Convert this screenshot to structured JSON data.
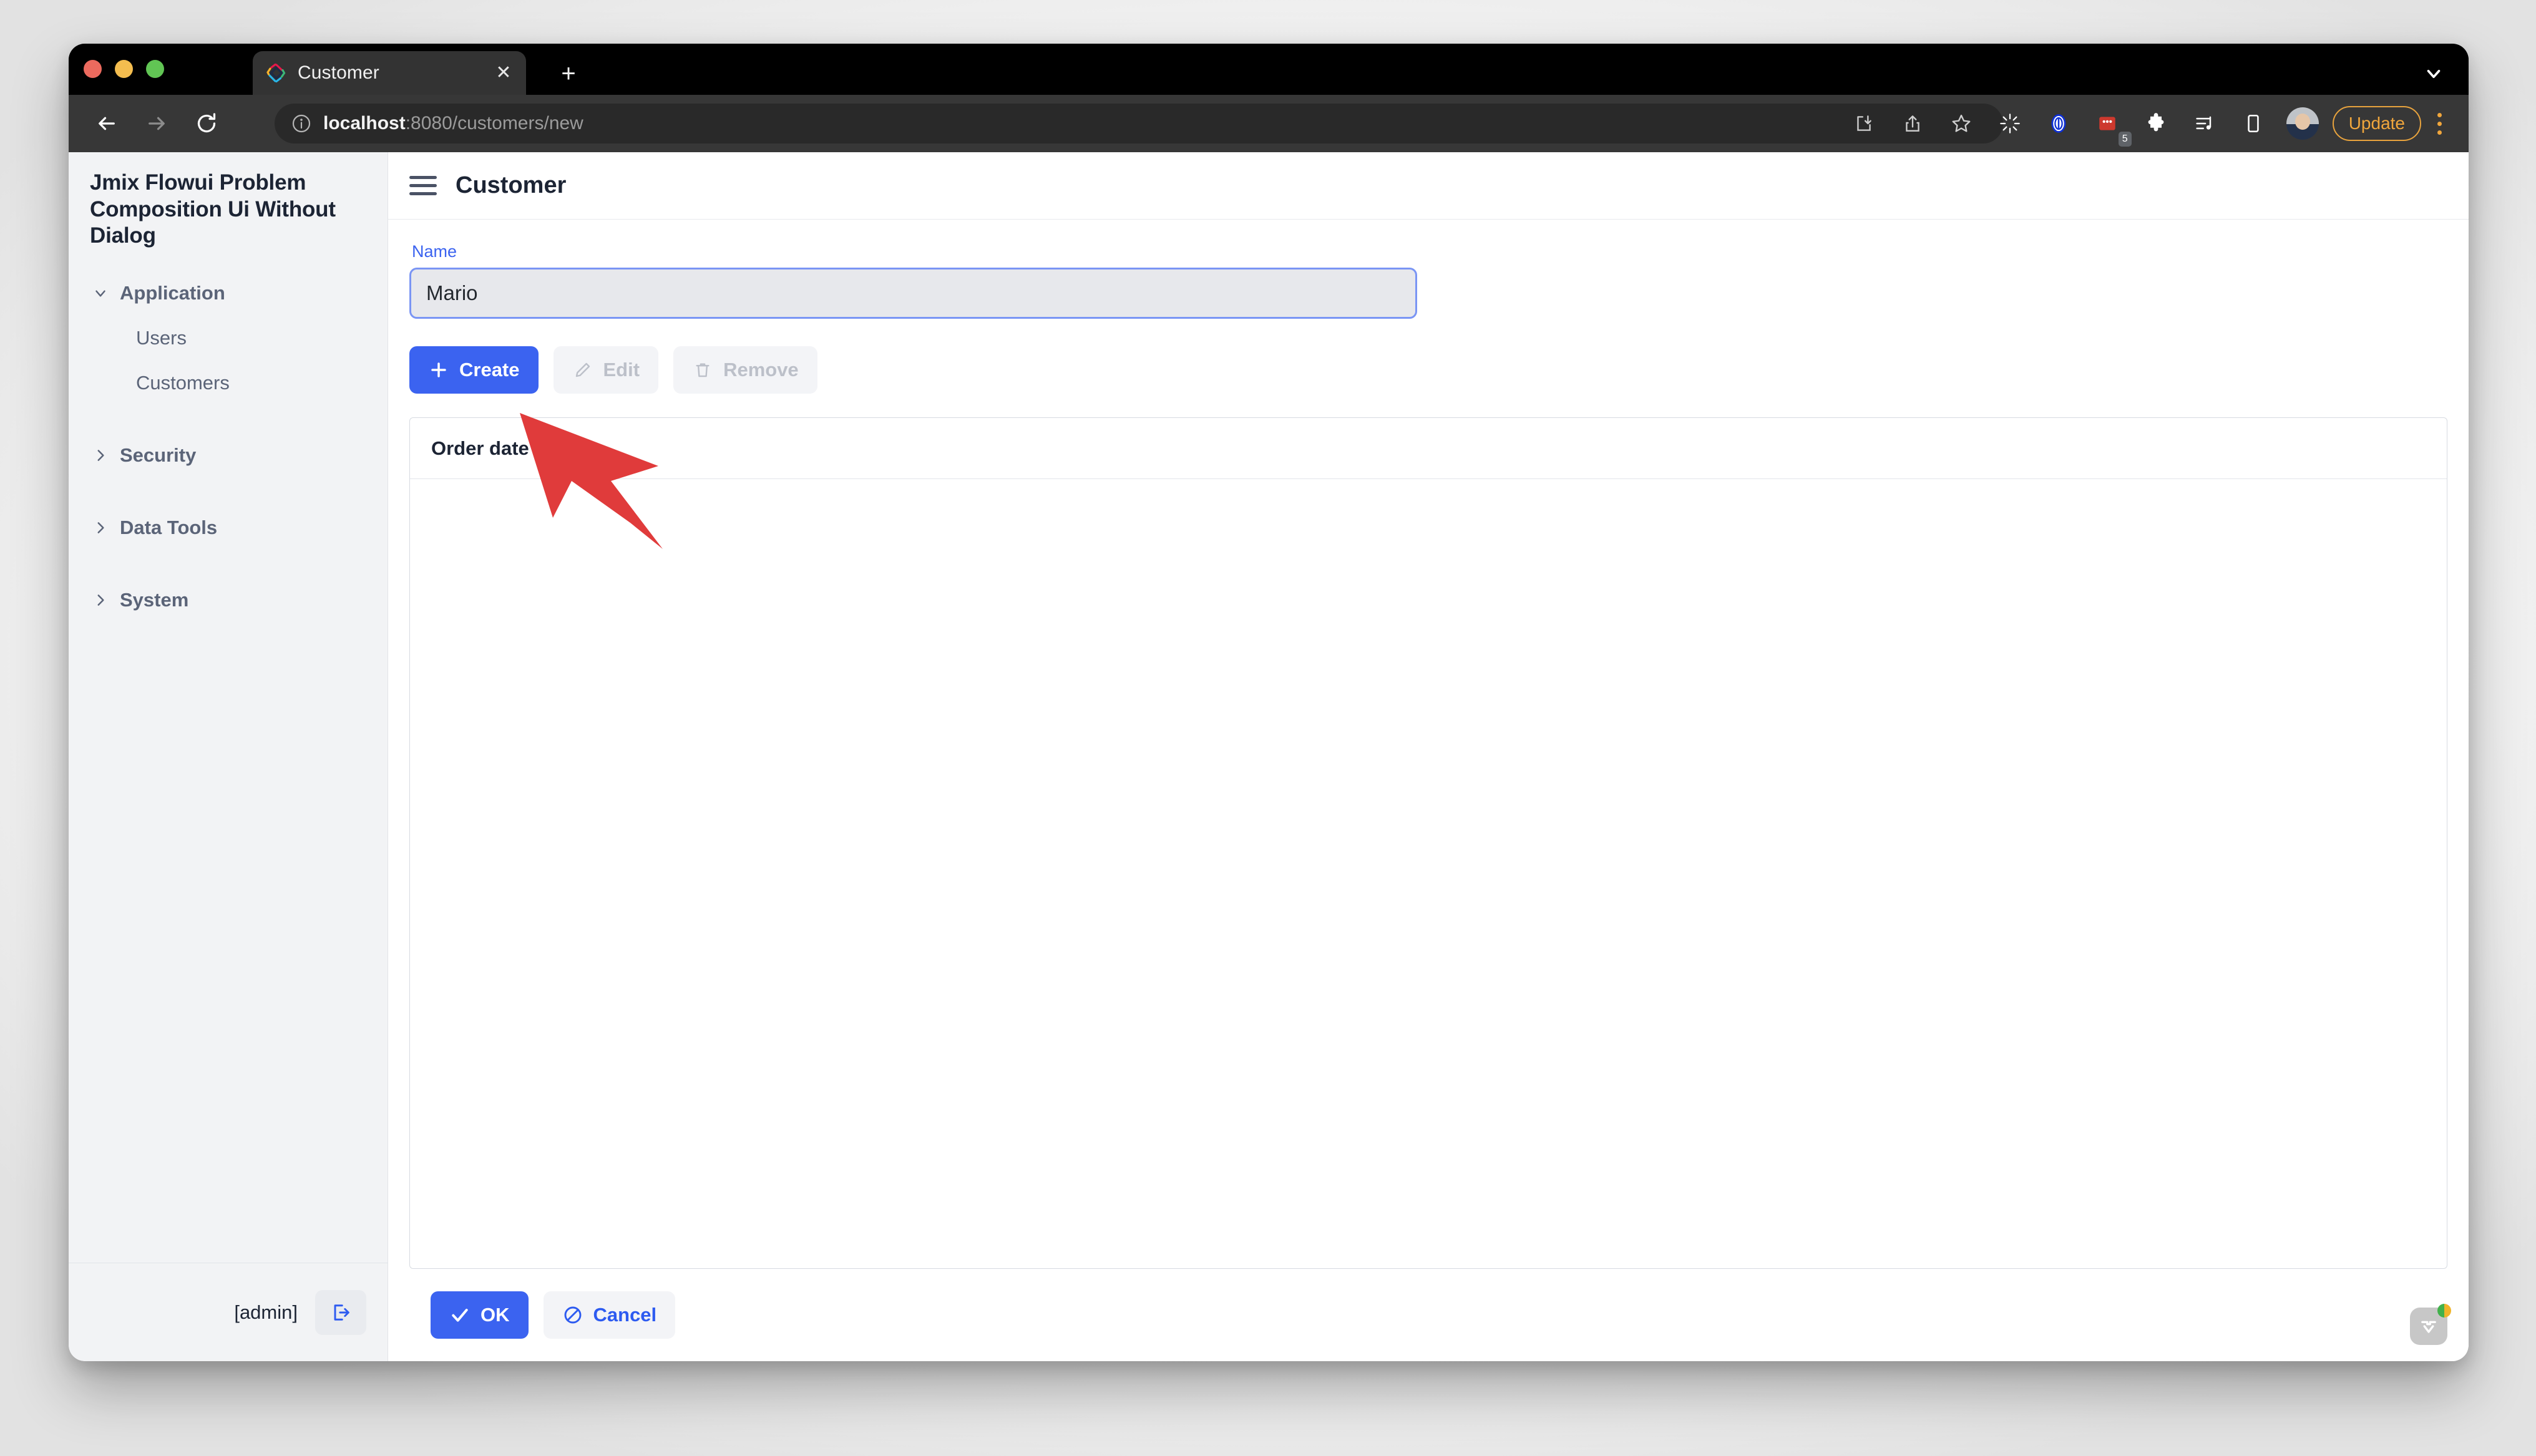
{
  "browser": {
    "tab": {
      "title": "Customer",
      "favicon": "jmix-logo-icon",
      "close_label": "✕"
    },
    "new_tab_label": "+",
    "url": {
      "host": "localhost",
      "rest": ":8080/customers/new"
    },
    "toolbar_icons": [
      "install-app-icon",
      "share-icon",
      "bookmark-star-icon",
      "loading-spinner-icon",
      "vimeo-circle-icon",
      "extension-red-icon",
      "puzzle-extensions-icon",
      "playlist-music-icon",
      "mobile-device-icon"
    ],
    "extension_badge": "5",
    "update_button": "Update",
    "nav": {
      "back": "back-arrow-icon",
      "forward": "forward-arrow-icon",
      "reload": "reload-icon"
    }
  },
  "sidebar": {
    "app_name": "Jmix Flowui Problem Composition Ui Without Dialog",
    "groups": [
      {
        "label": "Application",
        "expanded": true,
        "items": [
          {
            "label": "Users"
          },
          {
            "label": "Customers"
          }
        ]
      },
      {
        "label": "Security",
        "expanded": false,
        "items": []
      },
      {
        "label": "Data Tools",
        "expanded": false,
        "items": []
      },
      {
        "label": "System",
        "expanded": false,
        "items": []
      }
    ],
    "footer": {
      "user": "[admin]",
      "logout_icon": "sign-out-icon"
    }
  },
  "view": {
    "title": "Customer",
    "menu_icon": "hamburger-menu-icon",
    "form": {
      "name_label": "Name",
      "name_value": "Mario",
      "name_placeholder": ""
    },
    "actions": [
      {
        "label": "Create",
        "icon": "plus-icon",
        "style": "primary",
        "enabled": true
      },
      {
        "label": "Edit",
        "icon": "pencil-icon",
        "style": "ghost",
        "enabled": false
      },
      {
        "label": "Remove",
        "icon": "trash-icon",
        "style": "ghost",
        "enabled": false
      }
    ],
    "grid": {
      "columns": [
        {
          "label": "Order date",
          "sortable": true,
          "sort_icon": "sort-updown-icon"
        }
      ],
      "rows": []
    },
    "footer_actions": [
      {
        "label": "OK",
        "icon": "check-icon",
        "style": "primary"
      },
      {
        "label": "Cancel",
        "icon": "ban-circle-icon",
        "style": "ghost"
      }
    ]
  },
  "overlay": {
    "dev_tools": {
      "icon": "vaadin-devtools-icon",
      "status": "status-dot"
    },
    "annotation": {
      "type": "red-arrow",
      "color": "#e03b3b",
      "points_to": "Create"
    }
  },
  "colors": {
    "accent": "#3b63f0",
    "annotation_red": "#e03b3b",
    "sidebar_bg": "#f2f3f5",
    "text_dark": "#1c2434",
    "text_muted": "#5b6478"
  }
}
